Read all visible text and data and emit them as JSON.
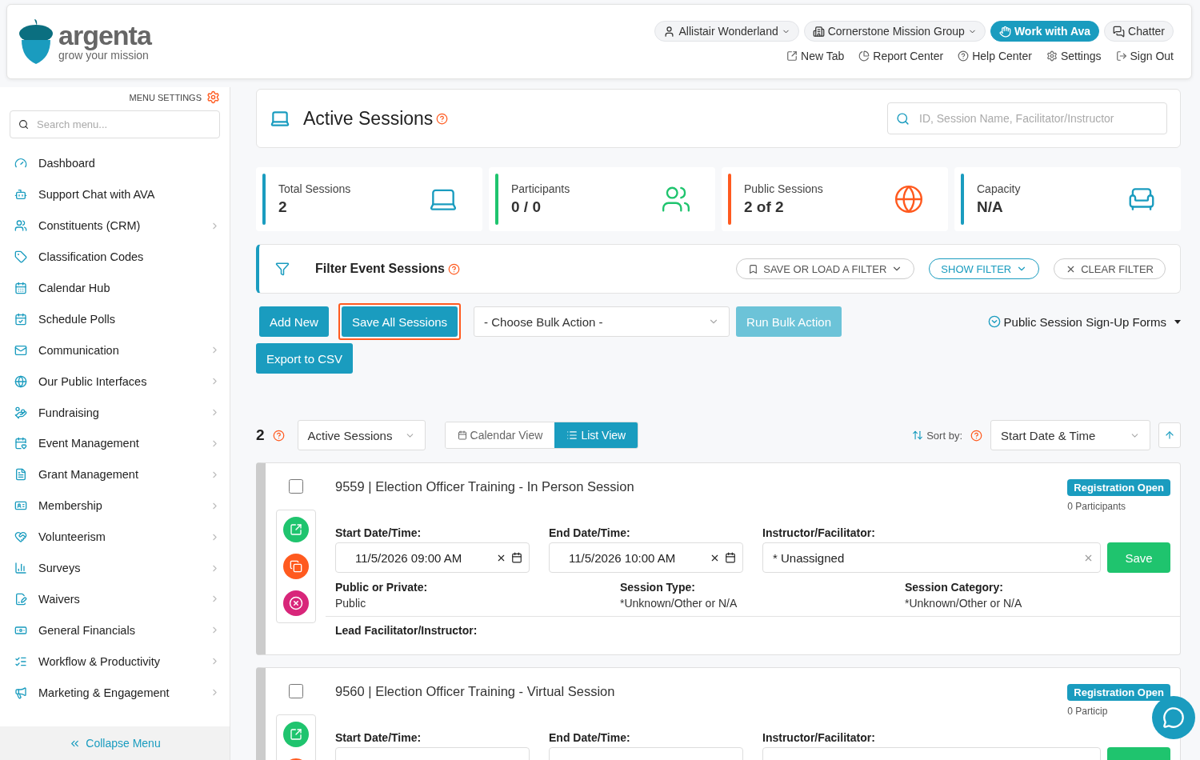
{
  "header": {
    "logo": {
      "name": "argenta",
      "tagline": "grow your mission"
    },
    "top_buttons": [
      {
        "label": "Allistair Wonderland",
        "kind": "user"
      },
      {
        "label": "Cornerstone Mission Group",
        "kind": "org"
      },
      {
        "label": "Work with Ava",
        "kind": "primary"
      },
      {
        "label": "Chatter",
        "kind": "chat"
      }
    ],
    "links": [
      "New Tab",
      "Report Center",
      "Help Center",
      "Settings",
      "Sign Out"
    ]
  },
  "sidebar": {
    "menu_settings": "MENU SETTINGS",
    "search_placeholder": "Search menu...",
    "items": [
      {
        "label": "Dashboard",
        "submenu": false
      },
      {
        "label": "Support Chat with AVA",
        "submenu": false
      },
      {
        "label": "Constituents (CRM)",
        "submenu": true
      },
      {
        "label": "Classification Codes",
        "submenu": false
      },
      {
        "label": "Calendar Hub",
        "submenu": false
      },
      {
        "label": "Schedule Polls",
        "submenu": false
      },
      {
        "label": "Communication",
        "submenu": true
      },
      {
        "label": "Our Public Interfaces",
        "submenu": true
      },
      {
        "label": "Fundraising",
        "submenu": true
      },
      {
        "label": "Event Management",
        "submenu": true
      },
      {
        "label": "Grant Management",
        "submenu": true
      },
      {
        "label": "Membership",
        "submenu": true
      },
      {
        "label": "Volunteerism",
        "submenu": true
      },
      {
        "label": "Surveys",
        "submenu": true
      },
      {
        "label": "Waivers",
        "submenu": true
      },
      {
        "label": "General Financials",
        "submenu": true
      },
      {
        "label": "Workflow & Productivity",
        "submenu": true
      },
      {
        "label": "Marketing & Engagement",
        "submenu": true
      }
    ],
    "collapse": "Collapse Menu"
  },
  "page": {
    "title": "Active Sessions",
    "search_placeholder": "ID, Session Name, Facilitator/Instructor"
  },
  "stats": [
    {
      "label": "Total Sessions",
      "value": "2",
      "color": "#1a9cbf"
    },
    {
      "label": "Participants",
      "value": "0 / 0",
      "color": "#1fc46e"
    },
    {
      "label": "Public Sessions",
      "value": "2 of 2",
      "color": "#ff5a1f"
    },
    {
      "label": "Capacity",
      "value": "N/A",
      "color": "#1a9cbf"
    }
  ],
  "filter": {
    "title": "Filter Event Sessions",
    "buttons": [
      {
        "label": "SAVE OR LOAD A FILTER",
        "kind": "saved"
      },
      {
        "label": "SHOW FILTER",
        "kind": "show"
      },
      {
        "label": "CLEAR FILTER",
        "kind": "clear"
      }
    ]
  },
  "actions": {
    "buttons": [
      {
        "label": "Add New",
        "highlighted": false
      },
      {
        "label": "Save All Sessions",
        "highlighted": true
      }
    ],
    "bulk_placeholder": "- Choose Bulk Action -",
    "run": {
      "label": "Run Bulk Action",
      "disabled": true
    },
    "export": "Export to CSV",
    "forms": "Public Session Sign-Up Forms"
  },
  "list": {
    "count": "2",
    "status": "Active Sessions",
    "views": [
      {
        "label": "Calendar View",
        "selected": false
      },
      {
        "label": "List View",
        "selected": true
      }
    ],
    "sort_label": "Sort by:",
    "sort": "Start Date & Time"
  },
  "sessions": [
    {
      "checked": false,
      "title": "9559 | Election Officer Training - In Person Session",
      "status": "Registration Open",
      "participants": "0 Participants",
      "start_label": "Start Date/Time:",
      "start": "11/5/2026 09:00 AM",
      "end_label": "End Date/Time:",
      "end": "11/5/2026 10:00 AM",
      "instructor_label": "Instructor/Facilitator:",
      "instructor": "* Unassigned",
      "save": "Save",
      "details": [
        {
          "label": "Public or Private:",
          "value": "Public"
        },
        {
          "label": "Session Type:",
          "value": "*Unknown/Other or N/A"
        },
        {
          "label": "Session Category:",
          "value": "*Unknown/Other or N/A"
        }
      ],
      "lead_label": "Lead Facilitator/Instructor:"
    },
    {
      "checked": false,
      "title": "9560 | Election Officer Training - Virtual Session",
      "status": "Registration Open",
      "participants": "0 Particip",
      "start_label": "Start Date/Time:",
      "end_label": "End Date/Time:",
      "instructor_label": "Instructor/Facilitator:"
    }
  ]
}
